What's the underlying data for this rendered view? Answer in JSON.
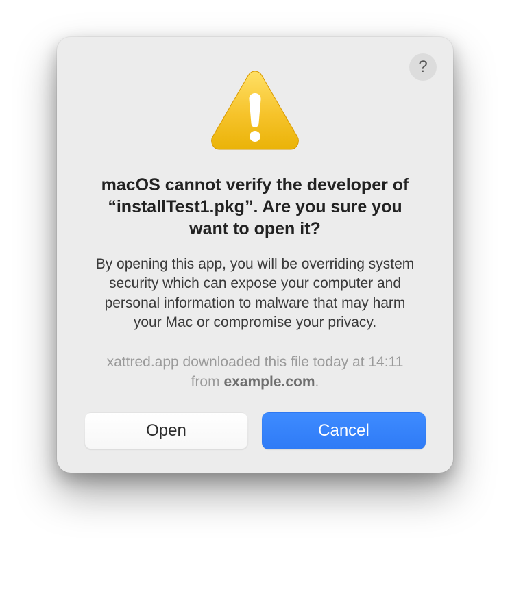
{
  "dialog": {
    "help_glyph": "?",
    "title": "macOS cannot verify the developer of “installTest1.pkg”. Are you sure you want to open it?",
    "body": "By opening this app, you will be overriding system security which can expose your computer and personal information to malware that may harm your Mac or compromise your privacy.",
    "download_prefix": "xattred.app downloaded this file today at 14:11 from ",
    "download_domain": "example.com",
    "download_suffix": ".",
    "buttons": {
      "open": "Open",
      "cancel": "Cancel"
    }
  }
}
